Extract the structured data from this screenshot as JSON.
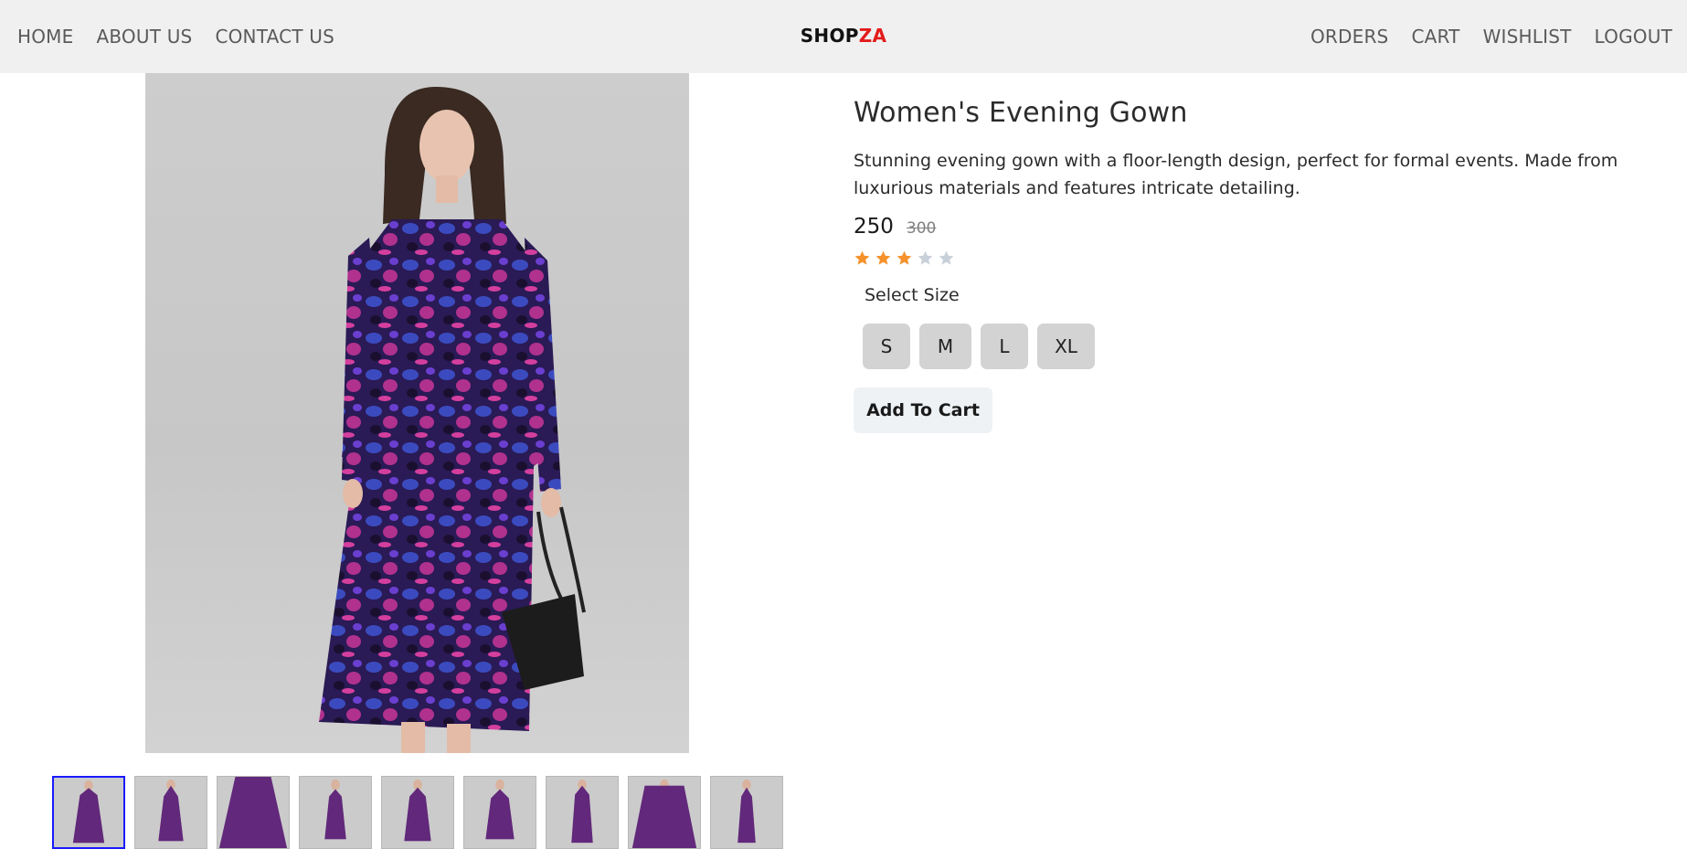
{
  "nav": {
    "left": [
      "HOME",
      "ABOUT US",
      "CONTACT US"
    ],
    "brand_part1": "SHOP",
    "brand_part2": "ZA",
    "right": [
      "ORDERS",
      "CART",
      "WISHLIST",
      "LOGOUT"
    ]
  },
  "product": {
    "title": "Women's Evening Gown",
    "description": "Stunning evening gown with a floor-length design, perfect for formal events. Made from luxurious materials and features intricate detailing.",
    "price": "250",
    "original_price": "300",
    "rating": 3,
    "rating_max": 5,
    "size_label": "Select Size",
    "sizes": [
      "S",
      "M",
      "L",
      "XL"
    ],
    "add_to_cart_label": "Add To Cart"
  },
  "gallery": {
    "thumbnail_count": 9,
    "selected_index": 0
  },
  "colors": {
    "brand_accent": "#e31b1b",
    "star_filled": "#f5922b",
    "star_empty": "#c8d0da",
    "thumb_selected_border": "#1a1aff"
  }
}
